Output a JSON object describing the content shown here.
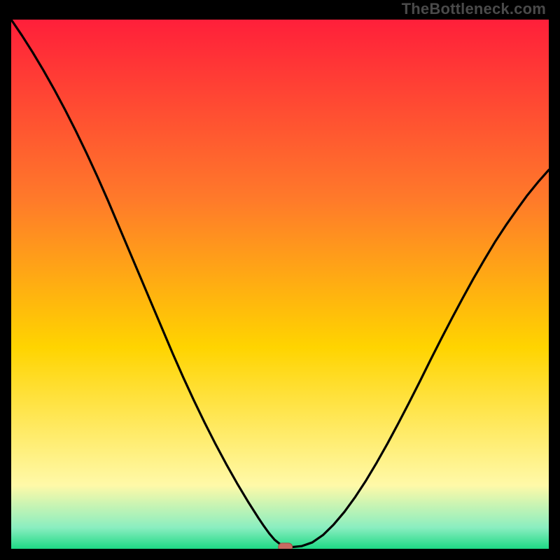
{
  "watermark": "TheBottleneck.com",
  "colors": {
    "bg": "#000000",
    "gradient_top": "#ff1f3a",
    "gradient_mid1": "#ff7a2a",
    "gradient_mid2": "#ffd400",
    "gradient_low1": "#fff9a8",
    "gradient_low2": "#8aeec0",
    "gradient_bottom": "#1ed985",
    "curve": "#000000",
    "marker_fill": "#c76a62",
    "marker_stroke": "#a14d46"
  },
  "chart_data": {
    "type": "line",
    "title": "",
    "xlabel": "",
    "ylabel": "",
    "xlim": [
      0,
      100
    ],
    "ylim": [
      0,
      100
    ],
    "x": [
      0,
      2,
      4,
      6,
      8,
      10,
      12,
      14,
      16,
      18,
      20,
      22,
      24,
      26,
      28,
      30,
      32,
      34,
      36,
      38,
      40,
      42,
      44,
      46,
      47,
      48,
      49,
      50,
      51,
      52,
      54,
      56,
      58,
      60,
      62,
      64,
      66,
      68,
      70,
      72,
      74,
      76,
      78,
      80,
      82,
      84,
      86,
      88,
      90,
      92,
      94,
      96,
      98,
      100
    ],
    "values": [
      100,
      97,
      93.8,
      90.4,
      86.8,
      83,
      79,
      74.8,
      70.4,
      65.8,
      61,
      56.2,
      51.4,
      46.6,
      41.8,
      37,
      32.4,
      28,
      23.8,
      19.8,
      16,
      12.4,
      9,
      5.8,
      4.3,
      2.9,
      1.7,
      0.9,
      0.4,
      0.3,
      0.5,
      1.2,
      2.6,
      4.6,
      7.0,
      9.8,
      12.9,
      16.3,
      19.9,
      23.7,
      27.6,
      31.6,
      35.7,
      39.7,
      43.6,
      47.4,
      51.1,
      54.6,
      58.0,
      61.1,
      64.0,
      66.8,
      69.3,
      71.6
    ],
    "marker": {
      "x": 51,
      "y": 0.35
    },
    "grid": false,
    "legend": false
  }
}
